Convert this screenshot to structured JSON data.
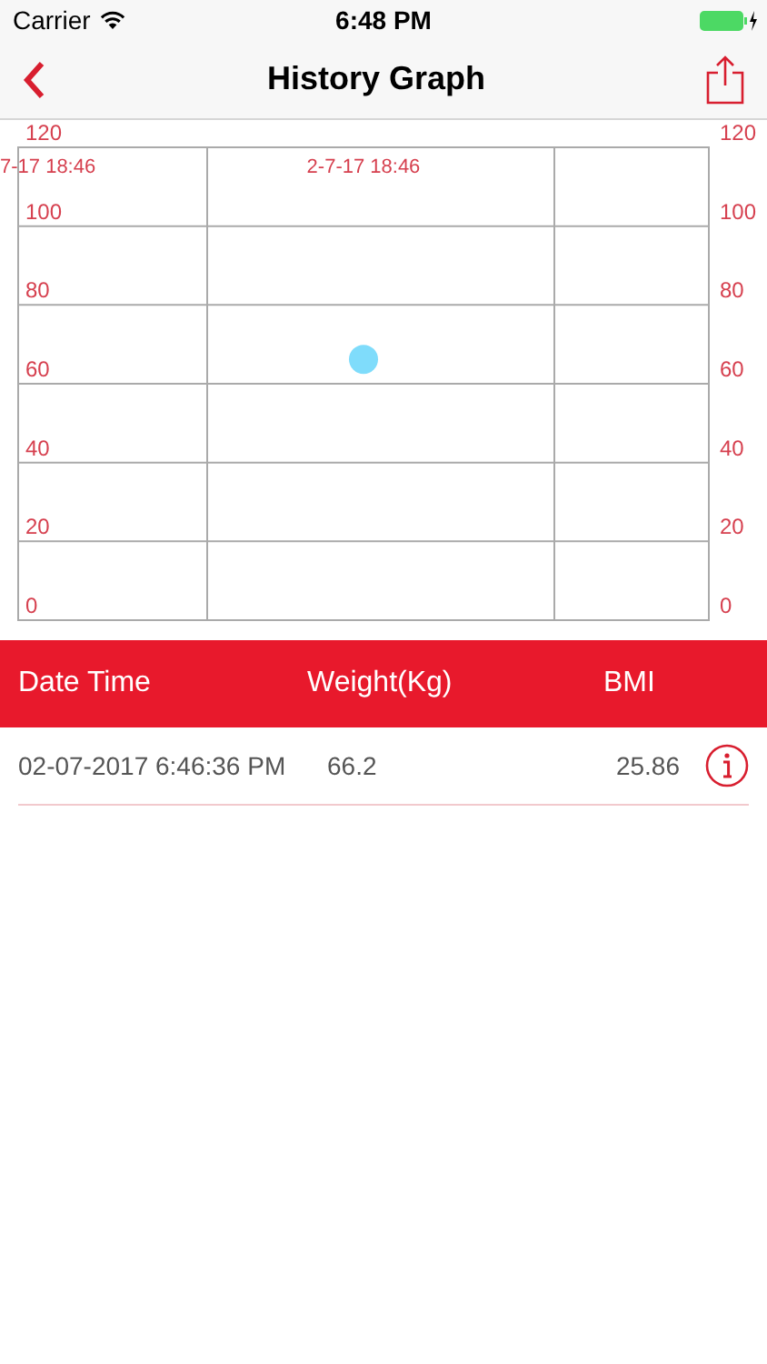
{
  "status_bar": {
    "carrier": "Carrier",
    "time": "6:48 PM"
  },
  "nav": {
    "title": "History Graph"
  },
  "chart": {
    "chart_data": {
      "type": "scatter",
      "categories": [
        "7-17 18:46",
        "2-7-17 18:46"
      ],
      "series": [
        {
          "color": "#7fdcfb",
          "values": [
            null,
            66.2
          ]
        }
      ],
      "ylim": [
        0,
        120
      ],
      "grid": true,
      "yticks": [
        120,
        100,
        80,
        60,
        40,
        20,
        0
      ]
    },
    "left_axis_labels": [
      "120",
      "100",
      "80",
      "60",
      "40",
      "20",
      "0"
    ],
    "right_axis_labels": [
      "120",
      "100",
      "80",
      "60",
      "40",
      "20",
      "0"
    ]
  },
  "table": {
    "columns": [
      "Date Time",
      "Weight(Kg)",
      "BMI"
    ],
    "rows": [
      {
        "date_time": "02-07-2017 6:46:36 PM",
        "weight": "66.2",
        "bmi": "25.86"
      }
    ]
  }
}
